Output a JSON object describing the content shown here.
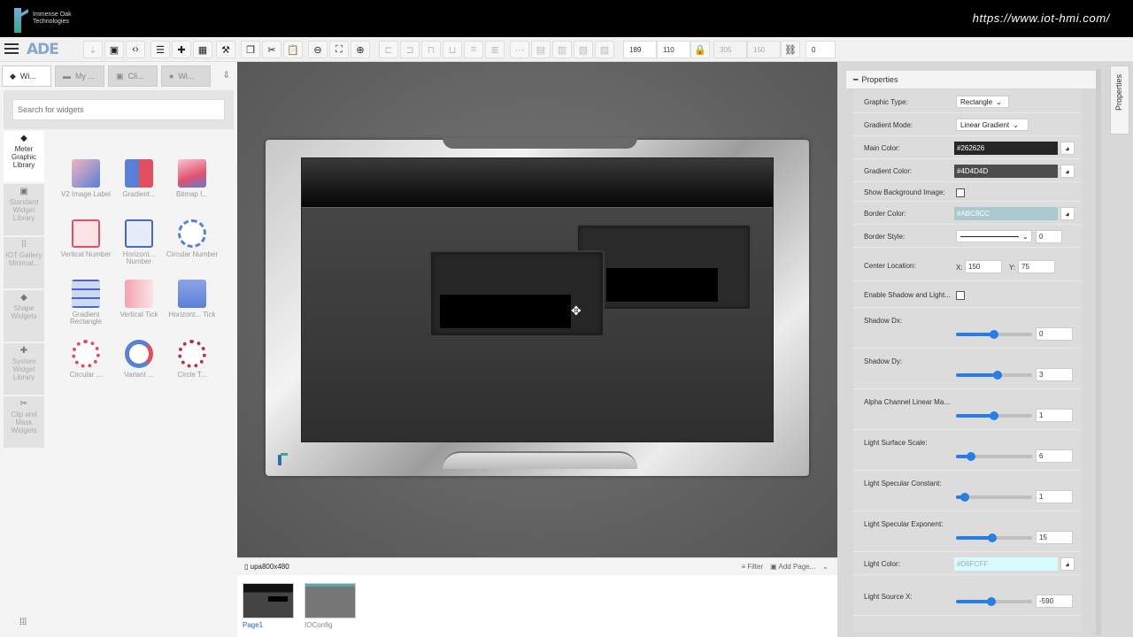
{
  "banner": {
    "brand_line1": "Immense Oak",
    "brand_line2": "Technologies",
    "url": "https://www.iot-hmi.com/"
  },
  "toolbar": {
    "app_logo": "ADE",
    "x_value": "189",
    "y_value": "110",
    "w_value": "305",
    "h_value": "150",
    "rotate_value": "0"
  },
  "left_tabs": [
    "Wi...",
    "My ...",
    "Cli...",
    "Wi..."
  ],
  "search": {
    "placeholder": "Search for widgets"
  },
  "libraries": [
    "Meter Graphic Library",
    "Standard Widget Library",
    "IOT Gallery Minimal...",
    "Shape Widgets",
    "System Widget Library",
    "Clip and Mask Widgets"
  ],
  "widgets": [
    "V2 Image Label",
    "Gradient...",
    "Bitmap I...",
    "Vertical Number",
    "Horizont... Number",
    "Circular Number",
    "Gradient Rectangle",
    "Vertical Tick",
    "Horizont... Tick",
    "Circular ...",
    "Variant ...",
    "Circle T..."
  ],
  "pages": {
    "title": "upa800x480",
    "filter": "Filter",
    "add_page": "Add Page...",
    "thumbs": [
      "Page1",
      "IOConfig"
    ]
  },
  "properties": {
    "header": "Properties",
    "tab_label": "Properties",
    "graphic_type_label": "Graphic Type:",
    "graphic_type": "Rectangle",
    "gradient_mode_label": "Gradient Mode:",
    "gradient_mode": "Linear Gradient",
    "main_color_label": "Main Color:",
    "main_color": "#262626",
    "gradient_color_label": "Gradient Color:",
    "gradient_color": "#4D4D4D",
    "show_bg_label": "Show Background Image:",
    "border_color_label": "Border Color:",
    "border_color": "#ABC9CC",
    "border_style_label": "Border Style:",
    "border_width": "0",
    "center_label": "Center Location:",
    "center_x_label": "X:",
    "center_x": "150",
    "center_y_label": "Y:",
    "center_y": "75",
    "shadow_enable_label": "Enable Shadow and Light...",
    "shadow_dx_label": "Shadow Dx:",
    "shadow_dx": "0",
    "shadow_dy_label": "Shadow Dy:",
    "shadow_dy": "3",
    "alpha_label": "Alpha Channel Linear Ma...",
    "alpha": "1",
    "surface_scale_label": "Light Surface Scale:",
    "surface_scale": "6",
    "spec_const_label": "Light Specular Constant:",
    "spec_const": "1",
    "spec_exp_label": "Light Specular Exponent:",
    "spec_exp": "15",
    "light_color_label": "Light Color:",
    "light_color": "#D6FCFF",
    "light_src_x_label": "Light Source X:",
    "light_src_x": "-590",
    "slider_levels": {
      "shadow_dx": 0.5,
      "shadow_dy": 0.55,
      "alpha": 0.5,
      "surface_scale": 0.2,
      "spec_const": 0.12,
      "spec_exp": 0.48,
      "light_src_x": 0.47
    }
  }
}
